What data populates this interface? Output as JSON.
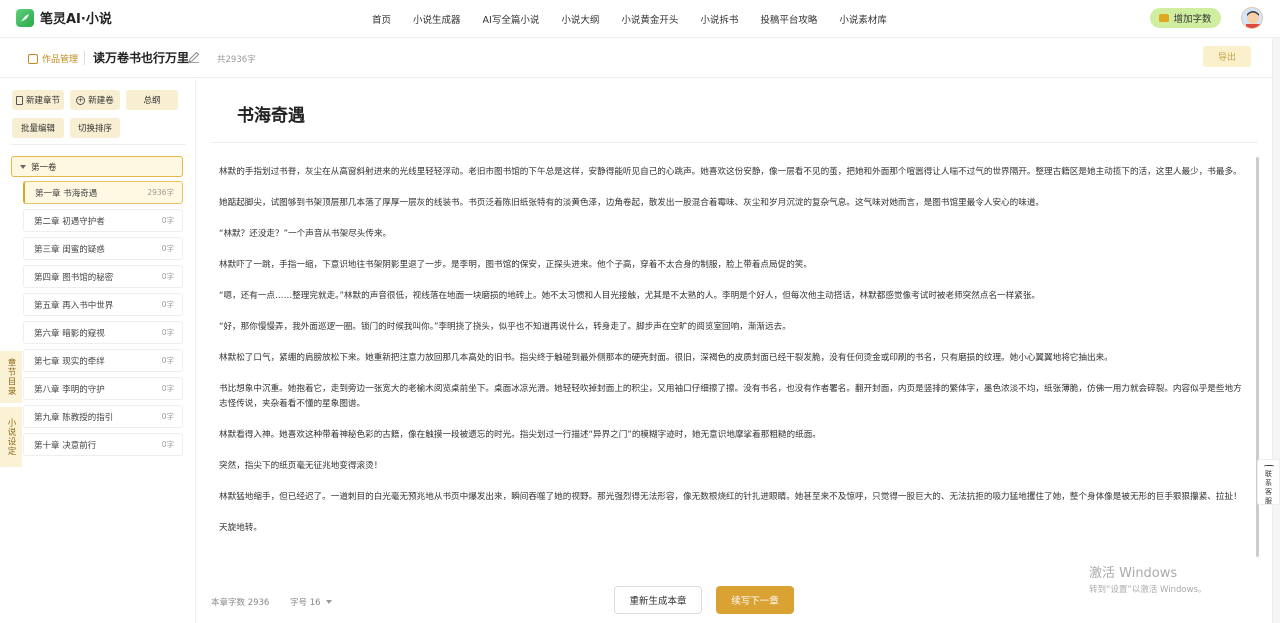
{
  "app": {
    "logo_text": "笔灵AI·小说"
  },
  "nav": {
    "items": [
      "首页",
      "小说生成器",
      "AI写全篇小说",
      "小说大纲",
      "小说黄金开头",
      "小说拆书",
      "投稿平台攻略",
      "小说素材库"
    ],
    "add_words_label": "增加字数"
  },
  "subheader": {
    "manage_label": "作品管理",
    "book_title": "读万卷书也行万里路",
    "word_total": "共2936字",
    "export_label": "导出"
  },
  "toolbar": {
    "new_chapter": "新建章节",
    "new_volume": "新建卷",
    "outline": "总纲",
    "batch_edit": "批量编辑",
    "toggle_sort": "切换排序"
  },
  "volume": {
    "name": "第一卷"
  },
  "chapters": [
    {
      "name": "第一章 书海奇遇",
      "count": "2936字"
    },
    {
      "name": "第二章 初遇守护者",
      "count": "0字"
    },
    {
      "name": "第三章 闺蜜的疑惑",
      "count": "0字"
    },
    {
      "name": "第四章 图书馆的秘密",
      "count": "0字"
    },
    {
      "name": "第五章 再入书中世界",
      "count": "0字"
    },
    {
      "name": "第六章 暗影的窥视",
      "count": "0字"
    },
    {
      "name": "第七章 现实的牵绊",
      "count": "0字"
    },
    {
      "name": "第八章 李明的守护",
      "count": "0字"
    },
    {
      "name": "第九章 陈教授的指引",
      "count": "0字"
    },
    {
      "name": "第十章 决意前行",
      "count": "0字"
    }
  ],
  "side_tabs": {
    "toc": "章节目录",
    "settings": "小说设定"
  },
  "editor": {
    "chapter_title": "书海奇遇",
    "paragraphs": [
      "林默的手指划过书脊，灰尘在从高窗斜射进来的光线里轻轻浮动。老旧市图书馆的下午总是这样，安静得能听见自己的心跳声。她喜欢这份安静，像一层看不见的茧，把她和外面那个喧嚣得让人喘不过气的世界隔开。整理古籍区是她主动揽下的活，这里人最少，书最多。",
      "她踮起脚尖，试图够到书架顶层那几本落了厚厚一层灰的线装书。书页泛着陈旧纸张特有的淡黄色泽，边角卷起，散发出一股混合着霉味、灰尘和岁月沉淀的复杂气息。这气味对她而言，是图书馆里最令人安心的味道。",
      "“林默？还没走？”一个声音从书架尽头传来。",
      "林默吓了一跳，手指一缩，下意识地往书架阴影里退了一步。是李明，图书馆的保安，正探头进来。他个子高，穿着不太合身的制服，脸上带着点局促的笑。",
      "“嗯，还有一点……整理完就走。”林默的声音很低，视线落在地面一块磨损的地砖上。她不太习惯和人目光接触，尤其是不太熟的人。李明是个好人，但每次他主动搭话，林默都感觉像考试时被老师突然点名一样紧张。",
      "“好，那你慢慢弄，我外面巡逻一圈。锁门的时候我叫你。”李明挠了挠头，似乎也不知道再说什么，转身走了。脚步声在空旷的阅览室回响，渐渐远去。",
      "林默松了口气，紧绷的肩膀放松下来。她重新把注意力放回那几本高处的旧书。指尖终于触碰到最外侧那本的硬壳封面。很旧，深褐色的皮质封面已经干裂发脆，没有任何烫金或印刷的书名，只有磨损的纹理。她小心翼翼地将它抽出来。",
      "书比想象中沉重。她抱着它，走到旁边一张宽大的老榆木阅览桌前坐下。桌面冰凉光滑。她轻轻吹掉封面上的积尘，又用袖口仔细擦了擦。没有书名，也没有作者署名。翻开封面，内页是竖排的繁体字，墨色浓淡不均，纸张薄脆，仿佛一用力就会碎裂。内容似乎是些地方志怪传说，夹杂着看不懂的星象图谱。",
      "林默看得入神。她喜欢这种带着神秘色彩的古籍，像在触摸一段被遗忘的时光。指尖划过一行描述“异界之门”的模糊字迹时，她无意识地摩挲着那粗糙的纸面。",
      "突然，指尖下的纸页毫无征兆地变得滚烫！",
      "林默猛地缩手，但已经迟了。一道刺目的白光毫无预兆地从书页中爆发出来，瞬间吞噬了她的视野。那光强烈得无法形容，像无数根烧红的针扎进眼睛。她甚至来不及惊呼，只觉得一股巨大的、无法抗拒的吸力猛地攫住了她，整个身体像是被无形的巨手狠狠攥紧、拉扯！",
      "天旋地转。"
    ],
    "word_count_label": "本章字数 2936",
    "font_size_label": "字号 16",
    "regen_label": "重新生成本章",
    "continue_label": "续写下一章"
  },
  "support": {
    "label": "联系客服"
  },
  "watermark": {
    "line1": "激活 Windows",
    "line2": "转到“设置”以激活 Windows。"
  }
}
